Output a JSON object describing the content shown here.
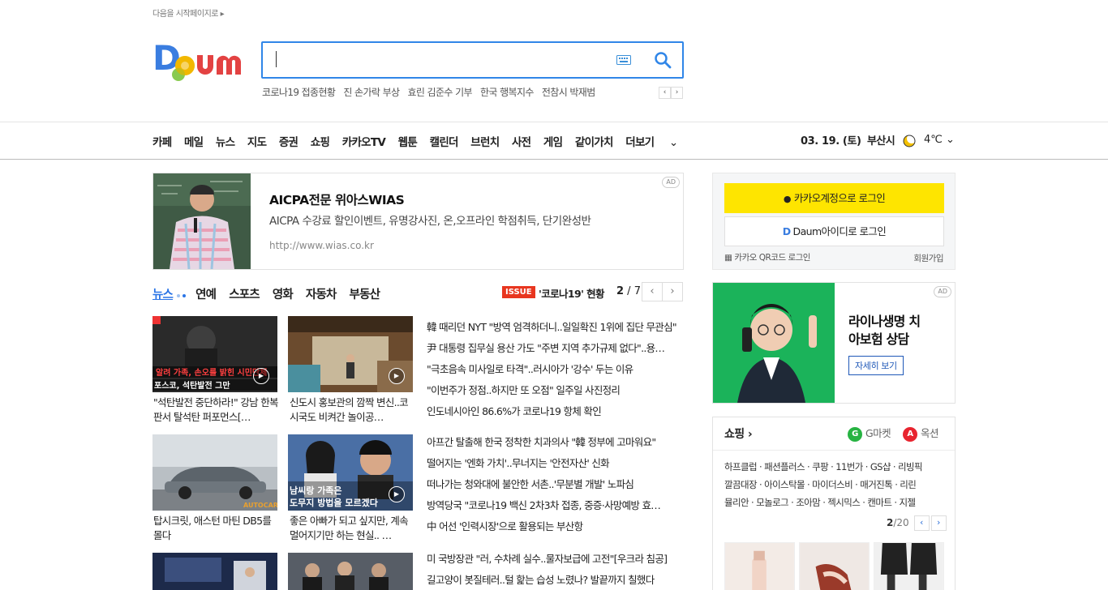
{
  "header": {
    "set_home": "다음을 시작페이지로 ▸",
    "logo_text": "Daum",
    "search": {
      "value": "",
      "placeholder": ""
    },
    "trending": [
      "코로나19 접종현황",
      "진 손가락 부상",
      "효린 김준수 기부",
      "한국 행복지수",
      "전참시 박재범"
    ],
    "trending_prev": "‹",
    "trending_next": "›"
  },
  "nav": {
    "items": [
      "카페",
      "메일",
      "뉴스",
      "지도",
      "증권",
      "쇼핑",
      "카카오TV",
      "웹툰",
      "캘린더",
      "브런치",
      "사전",
      "게임",
      "같이가치",
      "더보기"
    ],
    "date": "03. 19. (토)",
    "city": "부산시",
    "temperature": "4℃"
  },
  "ad_banner": {
    "tag": "AD",
    "title": "AICPA전문 위아스WIAS",
    "description": "AICPA 수강료 할인이벤트, 유명강사진, 온,오프라인 학점취득, 단기완성반",
    "url": "http://www.wias.co.kr"
  },
  "news": {
    "tabs": [
      "뉴스",
      "연예",
      "스포츠",
      "영화",
      "자동차",
      "부동산"
    ],
    "issue_badge": "ISSUE",
    "issue_text": "'코로나19' 현황",
    "page_current": "2",
    "page_total": " / 7",
    "prev": "‹",
    "next": "›",
    "thumb_cards": [
      {
        "caption": "\"석탄발전 중단하라!\" 강남 한복판서 탈석탄 퍼포먼스[…"
      },
      {
        "caption": "신도시 홍보관의 깜짝 변신..코시국도 비켜간 놀이공…"
      },
      {
        "caption": "탑시크릿, 애스턴 마틴 DB5를 몰다"
      },
      {
        "caption": "좋은 아빠가 되고 싶지만, 계속 멀어지기만 하는 현실.. …"
      }
    ],
    "headlines_1": [
      "韓 때리던 NYT \"방역 엄격하더니..일일확진 1위에 집단 무관심\"",
      "尹 대통령 집무실 용산 가도 \"주변 지역 추가규제 없다\"..용…",
      "\"극초음속 미사일로 타격\"..러시아가 '강수' 두는 이유",
      "\"이번주가 정점..하지만 또 오점\" 일주일 사진정리",
      "인도네시아인 86.6%가 코로나19 항체 확인"
    ],
    "headlines_2": [
      "아프간 탈출해 한국 정착한 치과의사 \"韓 정부에 고마워요\"",
      "떨어지는 '엔화 가치'..무너지는 '안전자산' 신화",
      "떠나가는 청와대에 불안한 서촌..'무분별 개발' 노파심",
      "방역당국 \"코로나19 백신 2차3차 접종, 중증·사망예방 효…",
      "中 어선 '인력시장'으로 활용되는 부산항"
    ],
    "headlines_3": [
      "미 국방장관 \"러, 수차례 실수..물자보급에 고전\"[우크라 침공]",
      "길고양이 봇질테러..털 핥는 습성 노렸나? 발끝까지 칠했다"
    ]
  },
  "login": {
    "kakao_label": "카카오계정으로 로그인",
    "daum_label": "Daum아이디로 로그인",
    "qr_label": "카카오 QR코드 로그인",
    "signup_label": "회원가입"
  },
  "right_ad": {
    "tag": "AD",
    "title_line1": "라이나생명 치",
    "title_line2": "아보험 상담",
    "button": "자세히 보기"
  },
  "shopping": {
    "title": "쇼핑 ›",
    "gmarket": "G마켓",
    "auction": "옥션",
    "links_row1": "하프클럽 · 패션플러스 · 쿠팡 · 11번가 · GS샵 · 리빙픽",
    "links_row2": "깔끔대장 · 아이스탁몰 · 마이더스비 · 매거진톡 · 리린",
    "links_row3": "뮬리안 · 모놀로그 · 조아맘 · 젝시믹스 · 캔마트 · 지젤",
    "page_current": "2",
    "page_total": "/20",
    "prev": "‹",
    "next": "›"
  },
  "colors": {
    "accent": "#3086e8",
    "kakao": "#fee500",
    "issue": "#e8361f",
    "ad_green": "#1bb35a"
  }
}
